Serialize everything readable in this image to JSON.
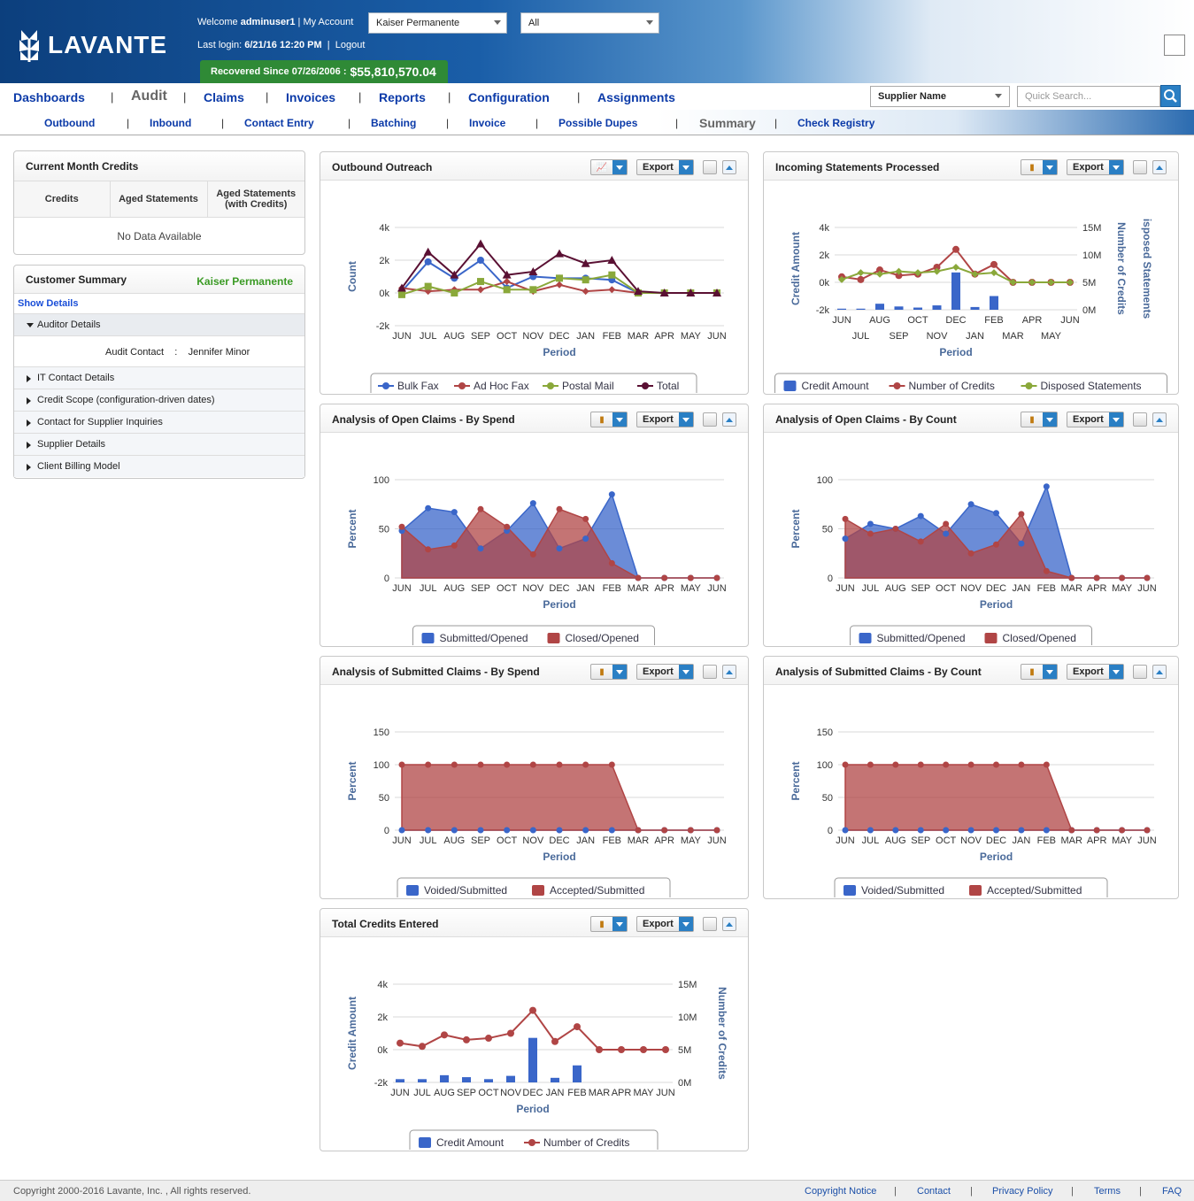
{
  "header": {
    "brand": "LAVANTE",
    "welcome_prefix": "Welcome",
    "username": "adminuser1",
    "my_account": "| My Account",
    "last_login_label": "Last login:",
    "last_login_value": "6/21/16 12:20 PM",
    "logout": "Logout",
    "client_select": "Kaiser Permanente",
    "scope_select": "All",
    "recovered_label": "Recovered Since 07/26/2006 :",
    "recovered_amount": "$55,810,570.04"
  },
  "nav": {
    "items": [
      "Dashboards",
      "Audit",
      "Claims",
      "Invoices",
      "Reports",
      "Configuration",
      "Assignments"
    ],
    "active": "Audit",
    "supplier_select": "Supplier Name",
    "search_placeholder": "Quick Search..."
  },
  "subnav": {
    "items": [
      "Outbound",
      "Inbound",
      "Contact Entry",
      "Batching",
      "Invoice",
      "Possible Dupes",
      "Summary",
      "Check Registry"
    ],
    "active": "Summary"
  },
  "current_month_credits": {
    "title": "Current Month Credits",
    "columns": [
      "Credits",
      "Aged Statements",
      "Aged Statements (with Credits)"
    ],
    "empty": "No Data Available"
  },
  "customer_summary": {
    "title": "Customer Summary",
    "customer": "Kaiser Permanente",
    "show_details": "Show Details",
    "sections": [
      "Auditor Details",
      "IT Contact Details",
      "Credit Scope (configuration-driven dates)",
      "Contact for Supplier Inquiries",
      "Supplier Details",
      "Client Billing Model"
    ],
    "audit_contact_label": "Audit Contact",
    "audit_contact_sep": ":",
    "audit_contact_value": "Jennifer Minor"
  },
  "toolbar": {
    "export": "Export"
  },
  "colors": {
    "blue": "#3a66c9",
    "red": "#b04545",
    "green": "#8aa83a",
    "maroon": "#5a1033",
    "axis": "#4a6a9a"
  },
  "footer": {
    "copyright": "Copyright 2000-2016 Lavante, Inc. , All rights reserved.",
    "links": [
      "Copyright Notice",
      "Contact",
      "Privacy Policy",
      "Terms",
      "FAQ"
    ]
  },
  "chart_data": [
    {
      "id": "outbound",
      "title": "Outbound Outreach",
      "type": "line",
      "xlabel": "Period",
      "ylabel": "Count",
      "ylim": [
        -2000,
        4000
      ],
      "yticks": [
        "4k",
        "2k",
        "0k",
        "-2k"
      ],
      "categories": [
        "JUN",
        "JUL",
        "AUG",
        "SEP",
        "OCT",
        "NOV",
        "DEC",
        "JAN",
        "FEB",
        "MAR",
        "APR",
        "MAY",
        "JUN"
      ],
      "series": [
        {
          "name": "Bulk Fax",
          "color": "#3a66c9",
          "values": [
            100,
            1900,
            900,
            2000,
            300,
            1000,
            900,
            900,
            800,
            0,
            0,
            0,
            0
          ]
        },
        {
          "name": "Ad Hoc Fax",
          "color": "#b04545",
          "values": [
            300,
            100,
            200,
            200,
            700,
            100,
            500,
            100,
            200,
            0,
            0,
            0,
            0
          ]
        },
        {
          "name": "Postal Mail",
          "color": "#8aa83a",
          "values": [
            -100,
            400,
            0,
            700,
            200,
            200,
            900,
            800,
            1100,
            0,
            0,
            0,
            0
          ]
        },
        {
          "name": "Total",
          "color": "#5a1033",
          "values": [
            300,
            2500,
            1100,
            3000,
            1100,
            1300,
            2400,
            1800,
            2000,
            100,
            0,
            0,
            0
          ]
        }
      ],
      "legend": "bottom"
    },
    {
      "id": "incoming",
      "title": "Incoming Statements Processed",
      "type": "combo",
      "xlabel": "Period",
      "ylabel": "Credit Amount",
      "ylabel_right": "Number of Credits",
      "ylabel_right2": "isposed Statements",
      "yticks": [
        "4k",
        "2k",
        "0k",
        "-2k"
      ],
      "yticks_right": [
        "15M",
        "10M",
        "5M",
        "0M"
      ],
      "categories": [
        "JUN",
        "JUL",
        "AUG",
        "SEP",
        "OCT",
        "NOV",
        "DEC",
        "JAN",
        "FEB",
        "MAR",
        "APR",
        "MAY",
        "JUN"
      ],
      "series": [
        {
          "name": "Credit Amount",
          "color": "#3a66c9",
          "kind": "bar",
          "values": [
            0.2,
            0.2,
            1.1,
            0.6,
            0.4,
            0.8,
            6.8,
            0.5,
            2.5,
            0,
            0,
            0,
            0
          ]
        },
        {
          "name": "Number of Credits",
          "color": "#b04545",
          "kind": "line",
          "values": [
            400,
            200,
            900,
            500,
            600,
            1100,
            2400,
            600,
            1300,
            0,
            0,
            0,
            0
          ]
        },
        {
          "name": "Disposed Statements",
          "color": "#8aa83a",
          "kind": "line",
          "values": [
            200,
            700,
            600,
            800,
            700,
            800,
            1100,
            600,
            700,
            0,
            0,
            0,
            0
          ]
        }
      ],
      "legend": "bottom"
    },
    {
      "id": "open_spend",
      "title": "Analysis of Open Claims - By Spend",
      "type": "area",
      "xlabel": "Period",
      "ylabel": "Percent",
      "ylim": [
        0,
        100
      ],
      "yticks": [
        "100",
        "50",
        "0"
      ],
      "categories": [
        "JUN",
        "JUL",
        "AUG",
        "SEP",
        "OCT",
        "NOV",
        "DEC",
        "JAN",
        "FEB",
        "MAR",
        "APR",
        "MAY",
        "JUN"
      ],
      "series": [
        {
          "name": "Submitted/Opened",
          "color": "#3a66c9",
          "values": [
            48,
            71,
            67,
            30,
            48,
            76,
            30,
            40,
            85,
            0,
            0,
            0,
            0
          ]
        },
        {
          "name": "Closed/Opened",
          "color": "#b04545",
          "values": [
            52,
            29,
            33,
            70,
            52,
            24,
            70,
            60,
            15,
            0,
            0,
            0,
            0
          ]
        }
      ],
      "legend": "bottom"
    },
    {
      "id": "open_count",
      "title": "Analysis of Open Claims - By Count",
      "type": "area",
      "xlabel": "Period",
      "ylabel": "Percent",
      "ylim": [
        0,
        100
      ],
      "yticks": [
        "100",
        "50",
        "0"
      ],
      "categories": [
        "JUN",
        "JUL",
        "AUG",
        "SEP",
        "OCT",
        "NOV",
        "DEC",
        "JAN",
        "FEB",
        "MAR",
        "APR",
        "MAY",
        "JUN"
      ],
      "series": [
        {
          "name": "Submitted/Opened",
          "color": "#3a66c9",
          "values": [
            40,
            55,
            50,
            63,
            45,
            75,
            66,
            35,
            93,
            0,
            0,
            0,
            0
          ]
        },
        {
          "name": "Closed/Opened",
          "color": "#b04545",
          "values": [
            60,
            45,
            50,
            37,
            55,
            25,
            34,
            65,
            7,
            0,
            0,
            0,
            0
          ]
        }
      ],
      "legend": "bottom"
    },
    {
      "id": "sub_spend",
      "title": "Analysis of Submitted Claims - By Spend",
      "type": "area",
      "xlabel": "Period",
      "ylabel": "Percent",
      "ylim": [
        0,
        150
      ],
      "yticks": [
        "150",
        "100",
        "50",
        "0"
      ],
      "categories": [
        "JUN",
        "JUL",
        "AUG",
        "SEP",
        "OCT",
        "NOV",
        "DEC",
        "JAN",
        "FEB",
        "MAR",
        "APR",
        "MAY",
        "JUN"
      ],
      "series": [
        {
          "name": "Voided/Submitted",
          "color": "#3a66c9",
          "values": [
            0,
            0,
            0,
            0,
            0,
            0,
            0,
            0,
            0,
            0,
            0,
            0,
            0
          ]
        },
        {
          "name": "Accepted/Submitted",
          "color": "#b04545",
          "values": [
            100,
            100,
            100,
            100,
            100,
            100,
            100,
            100,
            100,
            0,
            0,
            0,
            0
          ]
        }
      ],
      "legend": "bottom"
    },
    {
      "id": "sub_count",
      "title": "Analysis of Submitted Claims - By Count",
      "type": "area",
      "xlabel": "Period",
      "ylabel": "Percent",
      "ylim": [
        0,
        150
      ],
      "yticks": [
        "150",
        "100",
        "50",
        "0"
      ],
      "categories": [
        "JUN",
        "JUL",
        "AUG",
        "SEP",
        "OCT",
        "NOV",
        "DEC",
        "JAN",
        "FEB",
        "MAR",
        "APR",
        "MAY",
        "JUN"
      ],
      "series": [
        {
          "name": "Voided/Submitted",
          "color": "#3a66c9",
          "values": [
            0,
            0,
            0,
            0,
            0,
            0,
            0,
            0,
            0,
            0,
            0,
            0,
            0
          ]
        },
        {
          "name": "Accepted/Submitted",
          "color": "#b04545",
          "values": [
            100,
            100,
            100,
            100,
            100,
            100,
            100,
            100,
            100,
            0,
            0,
            0,
            0
          ]
        }
      ],
      "legend": "bottom"
    },
    {
      "id": "total_credits",
      "title": "Total Credits Entered",
      "type": "combo",
      "xlabel": "Period",
      "ylabel": "Credit Amount",
      "ylabel_right": "Number of Credits",
      "yticks": [
        "4k",
        "2k",
        "0k",
        "-2k"
      ],
      "yticks_right": [
        "15M",
        "10M",
        "5M",
        "0M"
      ],
      "categories": [
        "JUN",
        "JUL",
        "AUG",
        "SEP",
        "OCT",
        "NOV",
        "DEC",
        "JAN",
        "FEB",
        "MAR",
        "APR",
        "MAY",
        "JUN"
      ],
      "series": [
        {
          "name": "Credit Amount",
          "color": "#3a66c9",
          "kind": "bar",
          "values": [
            0.5,
            0.5,
            1.1,
            0.8,
            0.5,
            1.0,
            6.8,
            0.7,
            2.6,
            0,
            0,
            0,
            0
          ]
        },
        {
          "name": "Number of Credits",
          "color": "#b04545",
          "kind": "line",
          "values": [
            400,
            200,
            900,
            600,
            700,
            1000,
            2400,
            500,
            1400,
            0,
            0,
            0,
            0
          ]
        }
      ],
      "legend": "bottom"
    }
  ]
}
